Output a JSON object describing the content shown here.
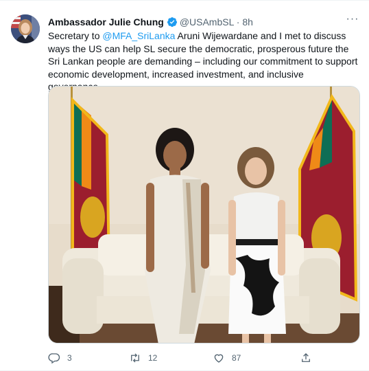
{
  "tweet": {
    "author_name": "Ambassador Julie Chung",
    "handle": "@USAmbSL",
    "separator": "·",
    "time": "8h",
    "text_before": "Secretary to ",
    "mention": "@MFA_SriLanka",
    "text_after": " Aruni Wijewardane and I met to discuss ways the US can help SL secure the democratic, prosperous future the Sri Lankan people are demanding – including our commitment to support economic development, increased investment, and inclusive governance.",
    "more_label": "···"
  },
  "actions": {
    "replies": "3",
    "retweets": "12",
    "likes": "87"
  },
  "colors": {
    "accent": "#1d9bf0",
    "secondary_text": "#536471",
    "text": "#0f1419"
  },
  "icons": [
    "verified-badge-icon",
    "more-options-icon",
    "reply-icon",
    "retweet-icon",
    "like-icon",
    "share-icon"
  ]
}
